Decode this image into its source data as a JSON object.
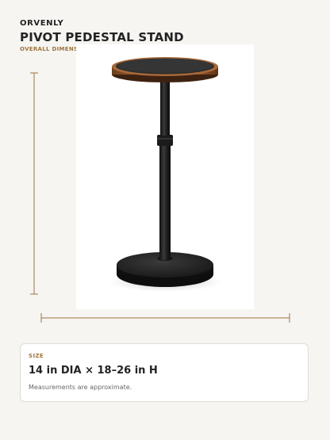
{
  "header": {
    "brand": "ORVENLY",
    "title": "PIVOT PEDESTAL STAND",
    "subtitle": "OVERALL DIMENSIONS"
  },
  "product": {
    "image_subject": "pedestal-side-table-photo"
  },
  "dimensions": {
    "line_color": "#a0743d"
  },
  "size_card": {
    "label": "SIZE",
    "value": "14 in DIA × 18–26 in H",
    "note": "Measurements are approximate."
  },
  "colors": {
    "accent": "#a0743d",
    "background": "#f6f5f2",
    "text": "#232323"
  }
}
